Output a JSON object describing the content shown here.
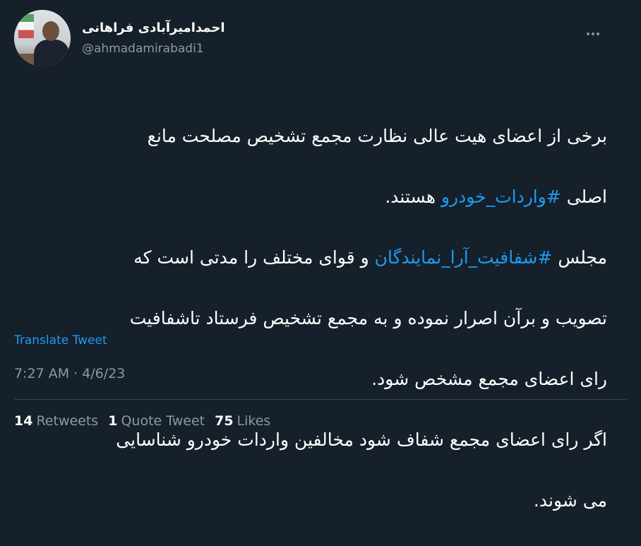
{
  "author": {
    "display_name": "احمدامیرآبادی فراهانی",
    "handle": "@ahmadamirabadi1"
  },
  "tweet": {
    "line1": "برخی از اعضای هیت عالی نظارت مجمع تشخیص مصلحت مانع",
    "line2_pre": "اصلی ",
    "hashtag1": "#واردات_خودرو",
    "line2_post": " هستند.",
    "line3_pre": "مجلس ",
    "hashtag2": "#شفافیت_آرا_نمایندگان",
    "line3_post": " و قوای مختلف را مدتی است که",
    "line4": "تصویب و برآن اصرار نموده و به مجمع تشخیص فرستاد تاشفافیت",
    "line5": "رای اعضای مجمع مشخص شود.",
    "line6": "اگر رای اعضای مجمع شفاف شود مخالفین واردات خودرو شناسایی",
    "line7": "می شوند."
  },
  "translate_label": "Translate Tweet",
  "timestamp": "7:27 AM · 4/6/23",
  "stats": {
    "retweets_count": "14",
    "retweets_label": "Retweets",
    "quotes_count": "1",
    "quotes_label": "Quote Tweet",
    "likes_count": "75",
    "likes_label": "Likes"
  },
  "colors": {
    "background": "#15202b",
    "accent": "#1d9bf0",
    "secondary_text": "#8b98a5"
  },
  "icons": {
    "more": "more-horizontal-icon"
  }
}
